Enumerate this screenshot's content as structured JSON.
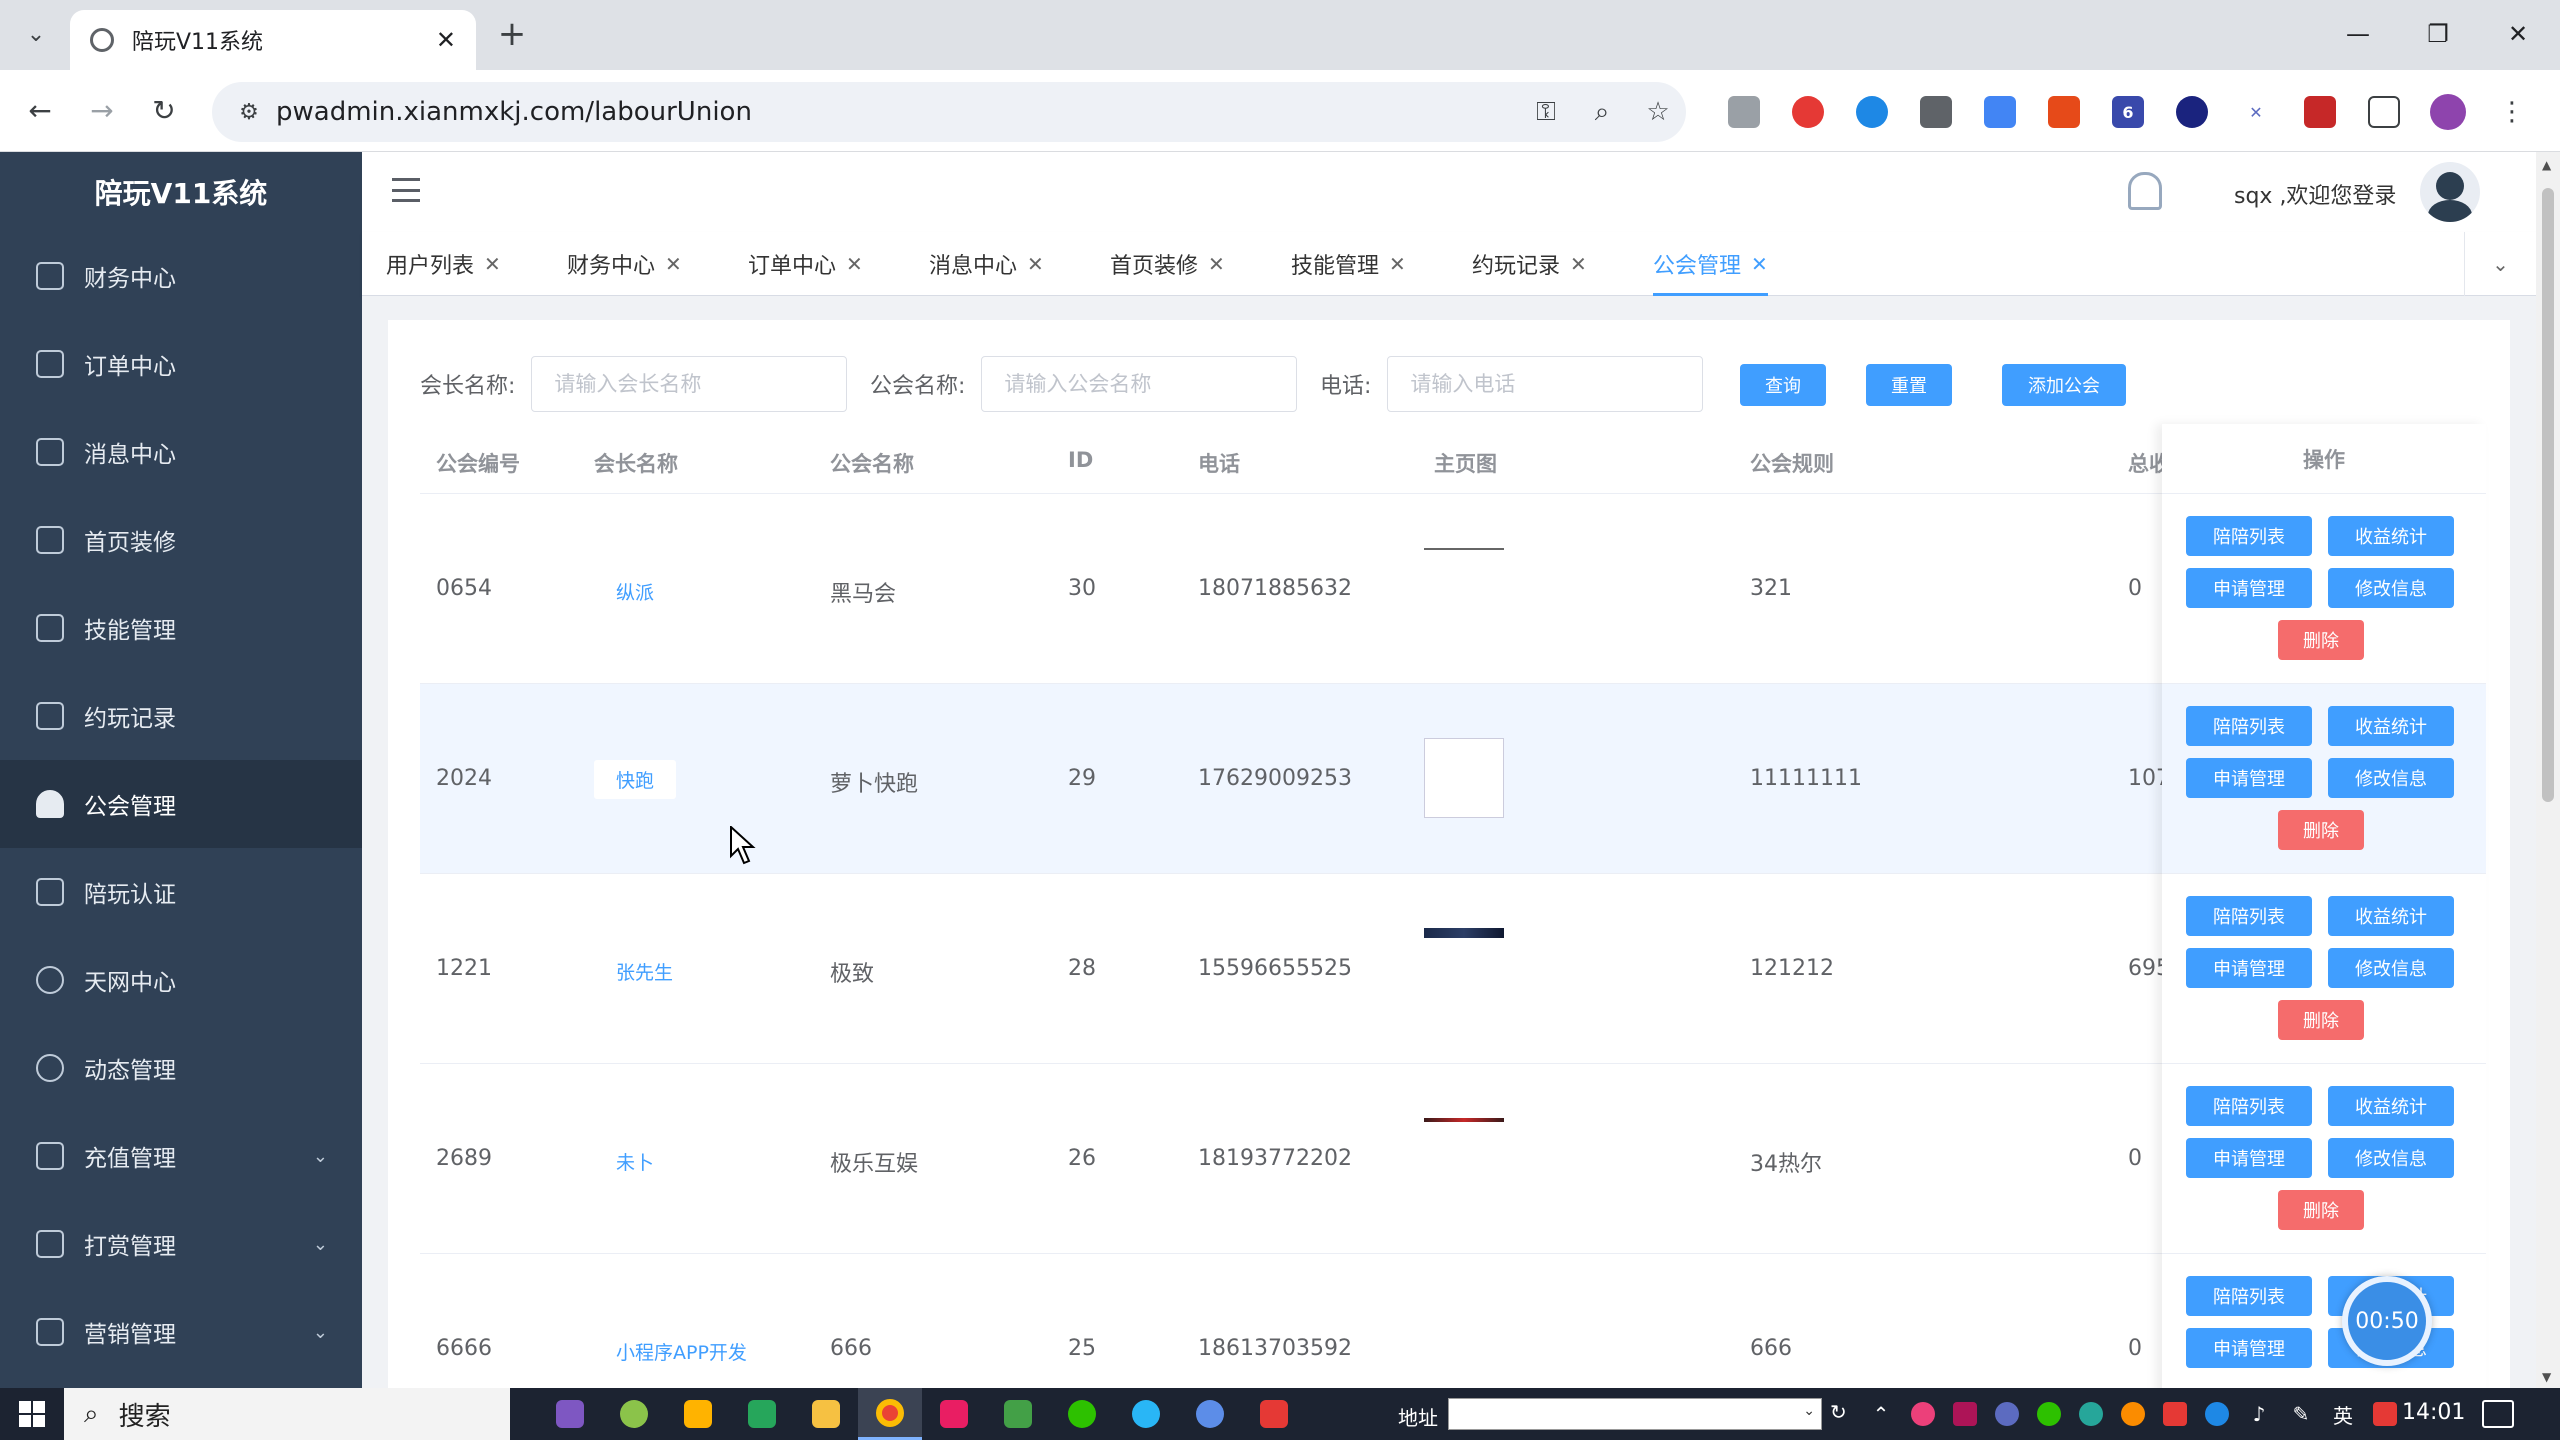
{
  "browser": {
    "tab_title": "陪玩V11系统",
    "tab_close": "✕",
    "new_tab": "+",
    "url": "pwadmin.xianmxkj.com/labourUnion",
    "minimize": "—",
    "restore": "❐",
    "close": "✕",
    "ext_badge": "6"
  },
  "sidebar": {
    "logo": "陪玩V11系统",
    "items": [
      {
        "label": "财务中心"
      },
      {
        "label": "订单中心"
      },
      {
        "label": "消息中心"
      },
      {
        "label": "首页装修"
      },
      {
        "label": "技能管理"
      },
      {
        "label": "约玩记录"
      },
      {
        "label": "公会管理"
      },
      {
        "label": "陪玩认证"
      },
      {
        "label": "天网中心"
      },
      {
        "label": "动态管理"
      },
      {
        "label": "充值管理"
      },
      {
        "label": "打赏管理"
      },
      {
        "label": "营销管理"
      }
    ]
  },
  "header": {
    "welcome": "sqx ,欢迎您登录"
  },
  "tags": [
    {
      "label": "用户列表"
    },
    {
      "label": "财务中心"
    },
    {
      "label": "订单中心"
    },
    {
      "label": "消息中心"
    },
    {
      "label": "首页装修"
    },
    {
      "label": "技能管理"
    },
    {
      "label": "约玩记录"
    },
    {
      "label": "公会管理"
    }
  ],
  "tag_close": "✕",
  "filters": {
    "leader_label": "会长名称:",
    "leader_placeholder": "请输入会长名称",
    "guild_label": "公会名称:",
    "guild_placeholder": "请输入公会名称",
    "phone_label": "电话:",
    "phone_placeholder": "请输入电话",
    "query": "查询",
    "reset": "重置",
    "add": "添加公会"
  },
  "table": {
    "headers": {
      "no": "公会编号",
      "leader": "会长名称",
      "guild": "公会名称",
      "id": "ID",
      "phone": "电话",
      "cover": "主页图",
      "rules": "公会规则",
      "total": "总收",
      "ops": "操作"
    },
    "rows": [
      {
        "no": "0654",
        "leader": "纵派",
        "guild": "黑马会",
        "id": "30",
        "phone": "18071885632",
        "rules": "321",
        "total": "0"
      },
      {
        "no": "2024",
        "leader": "快跑",
        "guild": "萝卜快跑",
        "id": "29",
        "phone": "17629009253",
        "rules": "11111111",
        "total": "107"
      },
      {
        "no": "1221",
        "leader": "张先生",
        "guild": "极致",
        "id": "28",
        "phone": "15596655525",
        "rules": "121212",
        "total": "695"
      },
      {
        "no": "2689",
        "leader": "未卜",
        "guild": "极乐互娱",
        "id": "26",
        "phone": "18193772202",
        "rules": "34热尔",
        "total": "0"
      },
      {
        "no": "6666",
        "leader": "小程序APP开发",
        "guild": "666",
        "id": "25",
        "phone": "18613703592",
        "rules": "666",
        "total": "0"
      }
    ],
    "op_labels": {
      "companions": "陪陪列表",
      "revenue": "收益统计",
      "applications": "申请管理",
      "edit": "修改信息",
      "delete": "删除"
    }
  },
  "timer": "00:50",
  "taskbar": {
    "search": "搜索",
    "address_label": "地址",
    "ime": "英",
    "time": "14:01"
  }
}
